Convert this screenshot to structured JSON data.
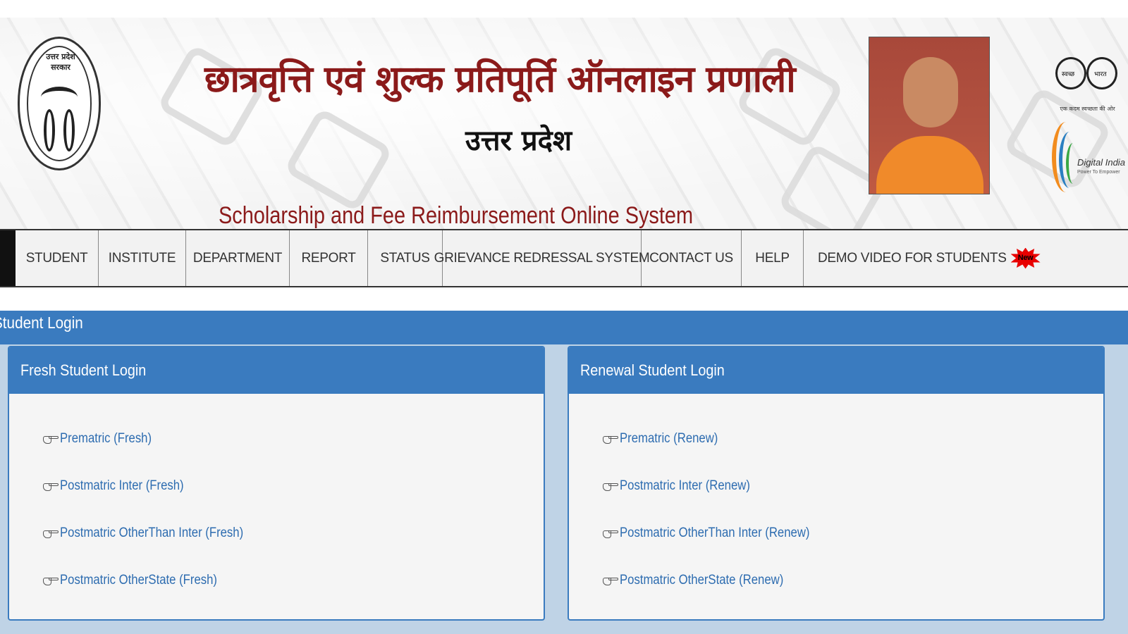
{
  "header": {
    "emblem_text": "उत्तर प्रदेश सरकार",
    "title_hindi": "छात्रवृत्ति एवं शुल्क प्रतिपूर्ति ऑनलाइन प्रणाली",
    "subtitle_hindi": "उत्तर प्रदेश",
    "title_english": "Scholarship and Fee Reimbursement Online System",
    "swachh_text": "एक कदम स्वच्छता की ओर",
    "swachh_left": "स्वच्छ",
    "swachh_right": "भारत",
    "digital_india": "Digital India",
    "digital_india_tagline": "Power To Empower"
  },
  "nav": {
    "items": [
      {
        "label": "STUDENT"
      },
      {
        "label": "INSTITUTE"
      },
      {
        "label": "DEPARTMENT"
      },
      {
        "label": "REPORT"
      },
      {
        "label": "STATUS"
      },
      {
        "label": "GRIEVANCE REDRESSAL SYSTEM"
      },
      {
        "label": "CONTACT US"
      },
      {
        "label": "HELP"
      },
      {
        "label": "DEMO VIDEO FOR STUDENTS"
      }
    ],
    "new_badge": "New"
  },
  "login": {
    "section_title": "Student Login",
    "fresh": {
      "title": "Fresh Student Login",
      "links": [
        "Prematric (Fresh)",
        "Postmatric Inter (Fresh)",
        "Postmatric OtherThan Inter (Fresh)",
        "Postmatric OtherState (Fresh)"
      ]
    },
    "renewal": {
      "title": "Renewal Student Login",
      "links": [
        "Prematric (Renew)",
        "Postmatric Inter (Renew)",
        "Postmatric OtherThan Inter (Renew)",
        "Postmatric OtherState (Renew)"
      ]
    }
  },
  "colors": {
    "brand_red": "#8b1a1a",
    "primary_blue": "#3a7bbf",
    "link_blue": "#2d6cb0",
    "panel_bg": "#bfd3e6"
  }
}
